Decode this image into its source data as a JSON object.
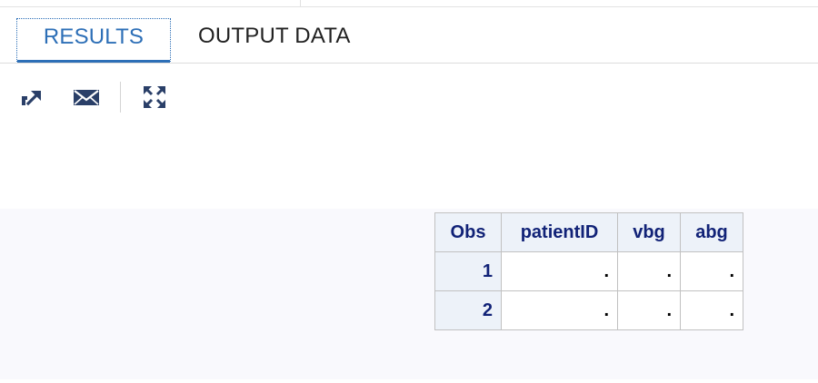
{
  "tabs": [
    {
      "label": "RESULTS",
      "active": true
    },
    {
      "label": "OUTPUT DATA",
      "active": false
    }
  ],
  "toolbar": {
    "icons": [
      "open-new-window-icon",
      "email-icon",
      "expand-icon"
    ]
  },
  "table": {
    "headers": [
      "Obs",
      "patientID",
      "vbg",
      "abg"
    ],
    "rows": [
      {
        "obs": "1",
        "cells": [
          ".",
          ".",
          "."
        ]
      },
      {
        "obs": "2",
        "cells": [
          ".",
          ".",
          "."
        ]
      }
    ]
  },
  "colors": {
    "accent": "#2d6fb7",
    "header_text": "#112277",
    "header_bg": "#edf2f9",
    "icon": "#2a3f68"
  }
}
